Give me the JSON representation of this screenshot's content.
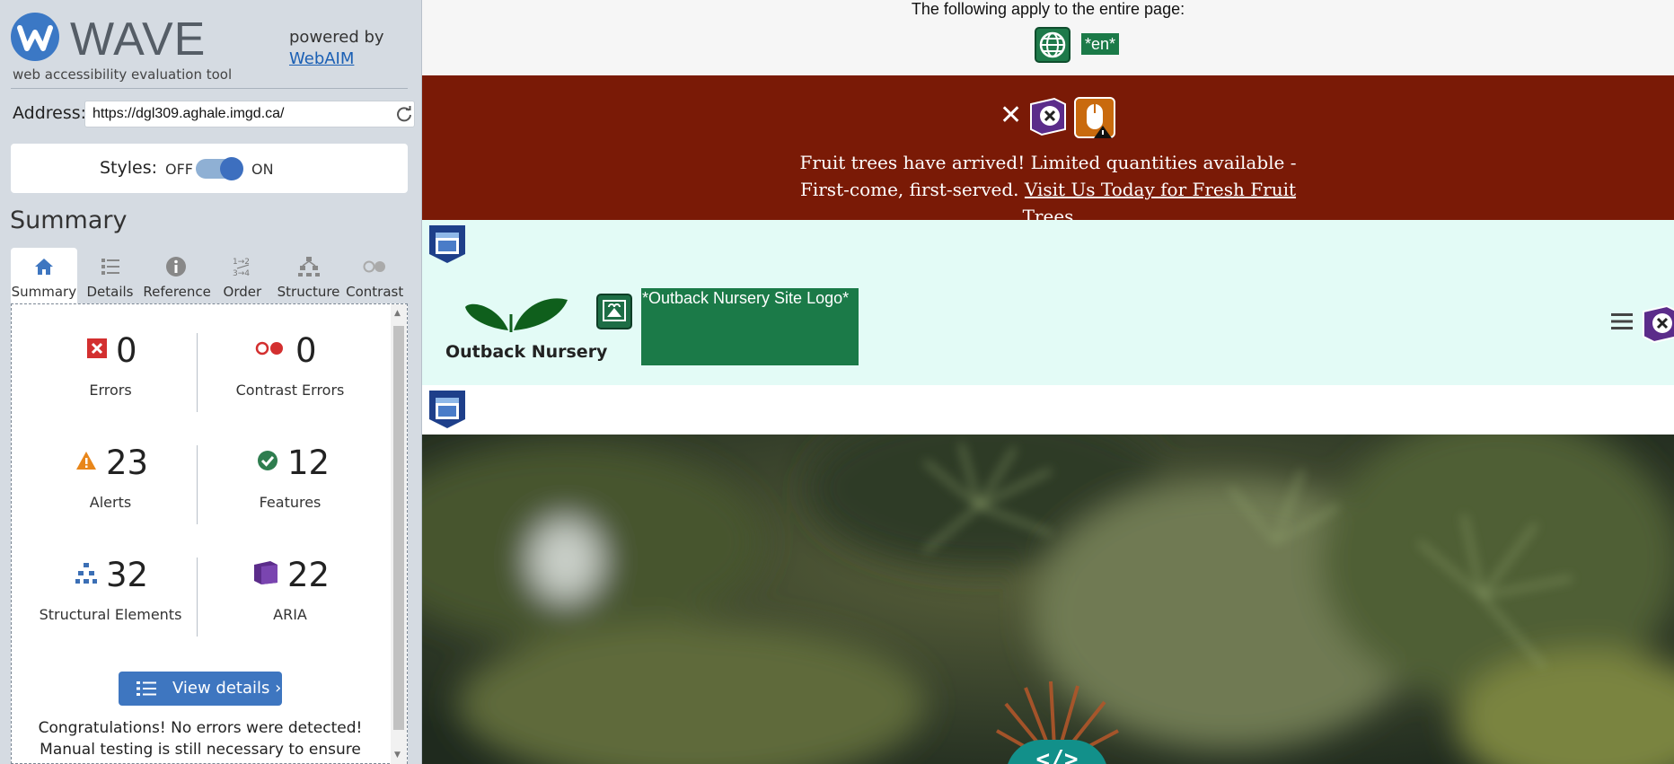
{
  "wave": {
    "title": "WAVE",
    "tagline": "web accessibility evaluation tool",
    "powered_by": "powered by",
    "webaim_link": "WebAIM",
    "address_label": "Address:",
    "address_value": "https://dgl309.aghale.imgd.ca/",
    "styles_label": "Styles:",
    "styles_off": "OFF",
    "styles_on": "ON",
    "summary_title": "Summary",
    "tabs": [
      {
        "label": "Summary",
        "icon": "home-icon",
        "active": true
      },
      {
        "label": "Details",
        "icon": "list-icon"
      },
      {
        "label": "Reference",
        "icon": "info-icon"
      },
      {
        "label": "Order",
        "icon": "order-icon"
      },
      {
        "label": "Structure",
        "icon": "hierarchy-icon"
      },
      {
        "label": "Contrast",
        "icon": "contrast-icon"
      }
    ],
    "stats": {
      "errors": {
        "count": "0",
        "label": "Errors",
        "color": "#d32f2f"
      },
      "contrast": {
        "count": "0",
        "label": "Contrast Errors",
        "color": "#d32f2f"
      },
      "alerts": {
        "count": "23",
        "label": "Alerts",
        "color": "#e8861a"
      },
      "features": {
        "count": "12",
        "label": "Features",
        "color": "#2e7d4f"
      },
      "structural": {
        "count": "32",
        "label": "Structural Elements",
        "color": "#3b6fb5"
      },
      "aria": {
        "count": "22",
        "label": "ARIA",
        "color": "#5b2c8a"
      }
    },
    "view_details": "View details ›",
    "congrats": "Congratulations! No errors were detected! Manual testing is still necessary to ensure"
  },
  "preview": {
    "notice": "The following apply to the entire page:",
    "lang": "*en*",
    "banner_text": "Fruit trees have arrived! Limited quantities available - First-come, first-served.",
    "banner_link": "Visit Us Today for Fresh Fruit Trees",
    "brand_name": "Outback Nursery",
    "logo_alt": "*Outback Nursery Site Logo*",
    "code_symbol": "</>",
    "colors": {
      "banner": "#7a1a06",
      "header": "#e3fbf6",
      "wave_green": "#1b7a48",
      "wave_blue": "#3e76c0"
    }
  }
}
